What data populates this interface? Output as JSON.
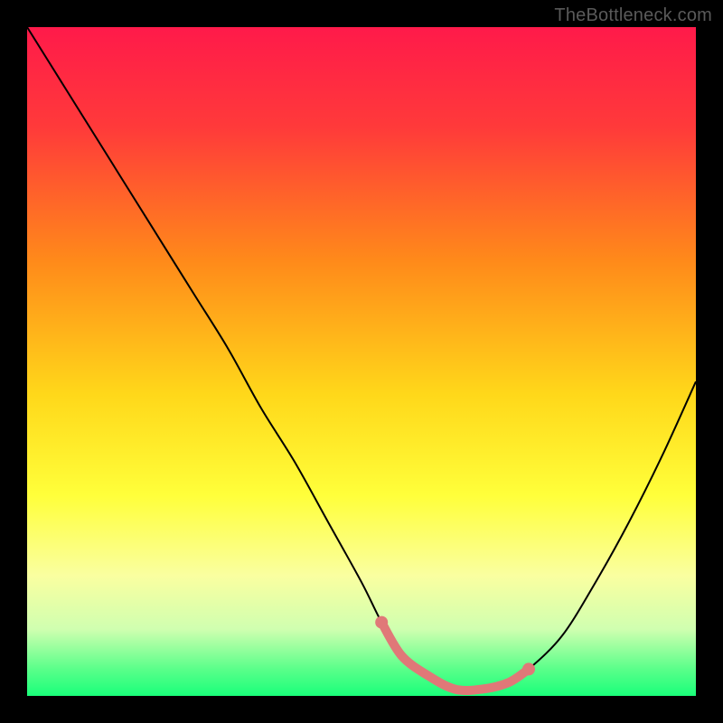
{
  "watermark": "TheBottleneck.com",
  "chart_data": {
    "type": "line",
    "title": "",
    "xlabel": "",
    "ylabel": "",
    "xlim": [
      0,
      100
    ],
    "ylim": [
      0,
      100
    ],
    "background_gradient": {
      "stops": [
        {
          "offset": 0,
          "color": "#ff1a4a"
        },
        {
          "offset": 15,
          "color": "#ff3a3a"
        },
        {
          "offset": 35,
          "color": "#ff8a1a"
        },
        {
          "offset": 55,
          "color": "#ffd81a"
        },
        {
          "offset": 70,
          "color": "#ffff3a"
        },
        {
          "offset": 82,
          "color": "#faffa0"
        },
        {
          "offset": 90,
          "color": "#d0ffb0"
        },
        {
          "offset": 96,
          "color": "#5aff8a"
        },
        {
          "offset": 100,
          "color": "#1aff7a"
        }
      ]
    },
    "series": [
      {
        "name": "bottleneck-curve",
        "color": "#000000",
        "x": [
          0,
          5,
          10,
          15,
          20,
          25,
          30,
          35,
          40,
          45,
          50,
          53,
          56,
          60,
          64,
          68,
          72,
          75,
          80,
          85,
          90,
          95,
          100
        ],
        "y": [
          100,
          92,
          84,
          76,
          68,
          60,
          52,
          43,
          35,
          26,
          17,
          11,
          6,
          3,
          1,
          1,
          2,
          4,
          9,
          17,
          26,
          36,
          47
        ]
      },
      {
        "name": "highlight-segment",
        "color": "#e07878",
        "x": [
          53,
          56,
          60,
          64,
          68,
          72,
          75
        ],
        "y": [
          11,
          6,
          3,
          1,
          1,
          2,
          4
        ]
      }
    ],
    "highlight_endpoints": [
      {
        "x": 53,
        "y": 11
      },
      {
        "x": 75,
        "y": 4
      }
    ]
  }
}
